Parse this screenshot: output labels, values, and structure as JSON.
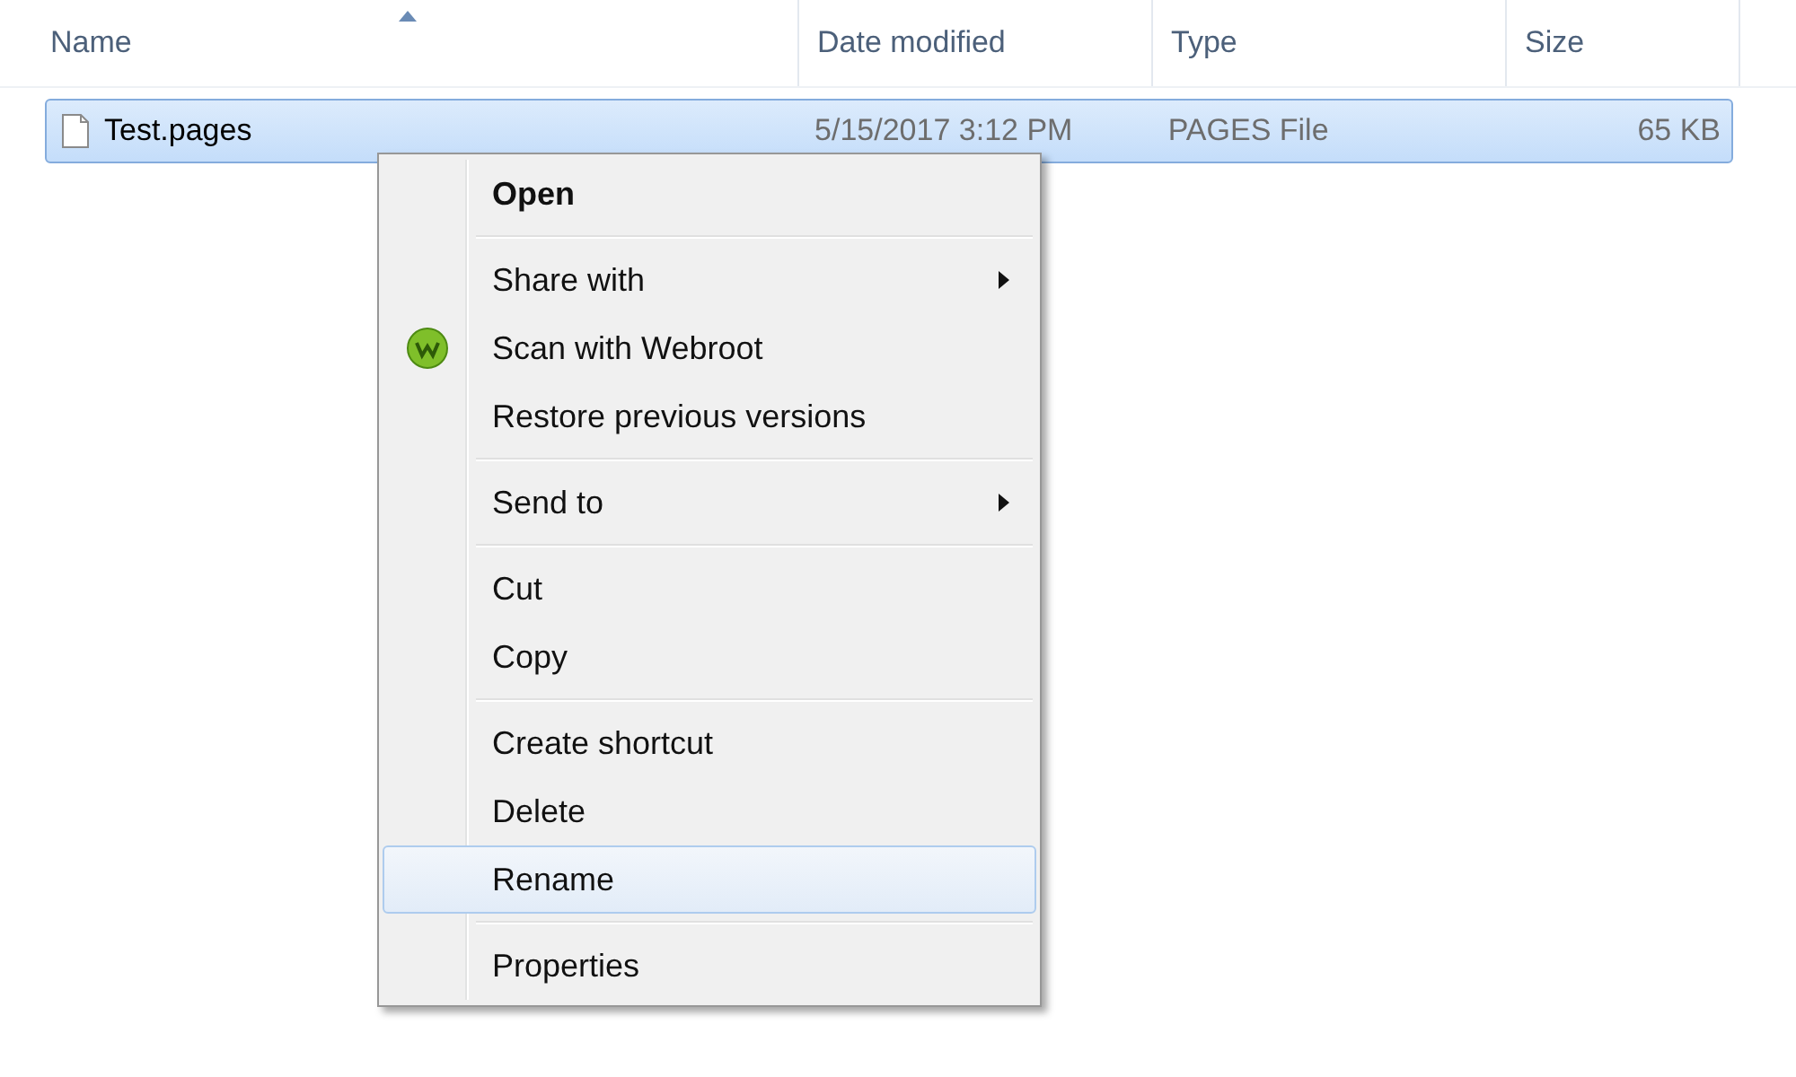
{
  "columns": [
    {
      "label": "Name",
      "sorted": true
    },
    {
      "label": "Date modified",
      "sorted": false
    },
    {
      "label": "Type",
      "sorted": false
    },
    {
      "label": "Size",
      "sorted": false
    }
  ],
  "files": [
    {
      "name": "Test.pages",
      "date": "5/15/2017 3:12 PM",
      "type": "PAGES File",
      "size": "65 KB",
      "selected": true
    }
  ],
  "context_menu": {
    "groups": [
      [
        {
          "label": "Open",
          "kind": "default",
          "selected": false
        }
      ],
      [
        {
          "label": "Share with",
          "kind": "submenu",
          "selected": false
        },
        {
          "label": "Scan with Webroot",
          "kind": "scan",
          "selected": false
        },
        {
          "label": "Restore previous versions",
          "kind": "plain",
          "selected": false
        }
      ],
      [
        {
          "label": "Send to",
          "kind": "submenu",
          "selected": false
        }
      ],
      [
        {
          "label": "Cut",
          "kind": "plain",
          "selected": false
        },
        {
          "label": "Copy",
          "kind": "plain",
          "selected": false
        }
      ],
      [
        {
          "label": "Create shortcut",
          "kind": "plain",
          "selected": false
        },
        {
          "label": "Delete",
          "kind": "plain",
          "selected": false
        },
        {
          "label": "Rename",
          "kind": "plain",
          "selected": true
        }
      ],
      [
        {
          "label": "Properties",
          "kind": "plain",
          "selected": false
        }
      ]
    ]
  }
}
